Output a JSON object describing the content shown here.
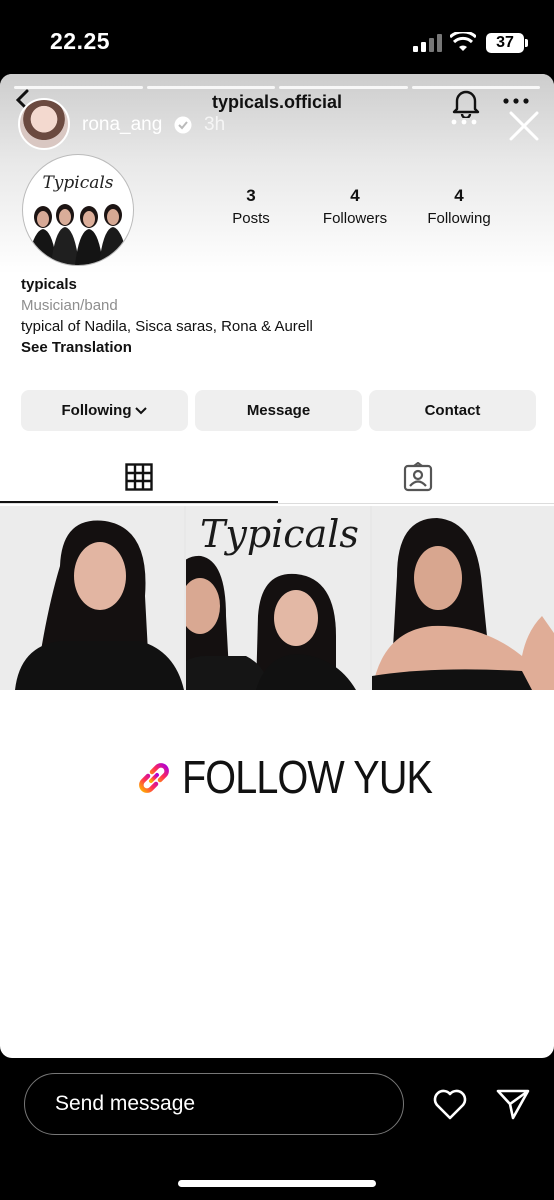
{
  "status_bar": {
    "time": "22.25",
    "battery": "37"
  },
  "story": {
    "username": "rona_ang",
    "time_ago": "3h",
    "segments": 4
  },
  "profile": {
    "username": "typicals.official",
    "avatar_logo_text": "Typicals",
    "stats": [
      {
        "value": "3",
        "label": "Posts"
      },
      {
        "value": "4",
        "label": "Followers"
      },
      {
        "value": "4",
        "label": "Following"
      }
    ],
    "name": "typicals",
    "category": "Musician/band",
    "bio": "typical of Nadila, Sisca saras, Rona & Aurell",
    "see_translation": "See Translation",
    "buttons": {
      "following": "Following",
      "message": "Message",
      "contact": "Contact"
    }
  },
  "posts": {
    "logo_text": "Typicals",
    "count": 3
  },
  "sticker": {
    "text": "FOLLOW YUK"
  },
  "reply_bar": {
    "placeholder": "Send message"
  },
  "colors": {
    "accent_gradient": [
      "#ff3d3d",
      "#c400c4",
      "#ffb000"
    ]
  }
}
